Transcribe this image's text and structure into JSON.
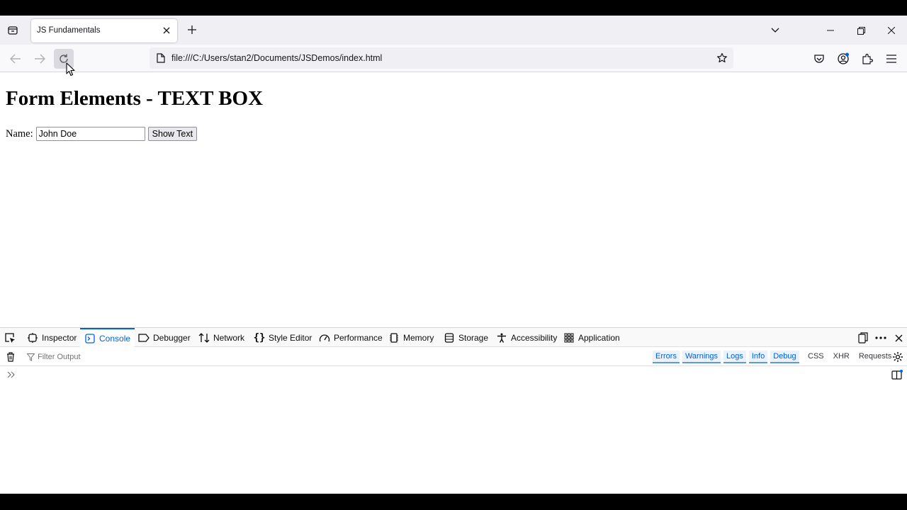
{
  "browser": {
    "tab": {
      "title": "JS Fundamentals"
    },
    "url": "file:///C:/Users/stan2/Documents/JSDemos/index.html"
  },
  "page": {
    "heading": "Form Elements - TEXT BOX",
    "name_label": "Name:",
    "name_value": "John Doe",
    "show_button": "Show Text"
  },
  "devtools": {
    "tabs": [
      {
        "label": "Inspector",
        "icon": "inspector-icon"
      },
      {
        "label": "Console",
        "icon": "console-icon"
      },
      {
        "label": "Debugger",
        "icon": "debugger-icon"
      },
      {
        "label": "Network",
        "icon": "network-icon"
      },
      {
        "label": "Style Editor",
        "icon": "style-editor-icon"
      },
      {
        "label": "Performance",
        "icon": "performance-icon"
      },
      {
        "label": "Memory",
        "icon": "memory-icon"
      },
      {
        "label": "Storage",
        "icon": "storage-icon"
      },
      {
        "label": "Accessibility",
        "icon": "accessibility-icon"
      },
      {
        "label": "Application",
        "icon": "application-icon"
      }
    ],
    "selected_tab": "Console",
    "filter_placeholder": "Filter Output",
    "levels": [
      "Errors",
      "Warnings",
      "Logs",
      "Info",
      "Debug"
    ],
    "types": [
      "CSS",
      "XHR",
      "Requests"
    ]
  },
  "colors": {
    "accent": "#0060df",
    "tabstrip": "#f0f0f4",
    "navbar": "#f9f9fb"
  }
}
